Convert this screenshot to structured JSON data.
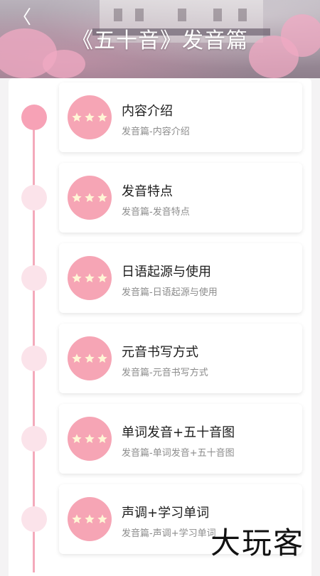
{
  "header": {
    "back_icon": "chevron-left-icon",
    "back_glyph": "〈",
    "title": "《五十音》发音篇"
  },
  "lessons": [
    {
      "title": "内容介绍",
      "subtitle": "发音篇-内容介绍",
      "active": true
    },
    {
      "title": "发音特点",
      "subtitle": "发音篇-发音特点",
      "active": false
    },
    {
      "title": "日语起源与使用",
      "subtitle": "发音篇-日语起源与使用",
      "active": false
    },
    {
      "title": "元音书写方式",
      "subtitle": "发音篇-元音书写方式",
      "active": false
    },
    {
      "title": "单词发音+五十音图",
      "subtitle": "发音篇-单词发音+五十音图",
      "active": false
    },
    {
      "title": "声调+学习单词",
      "subtitle": "发音篇-声调+学习单词",
      "active": false
    }
  ],
  "badge_icon": "three-stars-icon",
  "watermark": "大玩客",
  "colors": {
    "accent_pink": "#f6a5b5",
    "timeline": "#f4aabb",
    "node_inactive": "#fbe3ea",
    "star": "#fff6d6"
  }
}
